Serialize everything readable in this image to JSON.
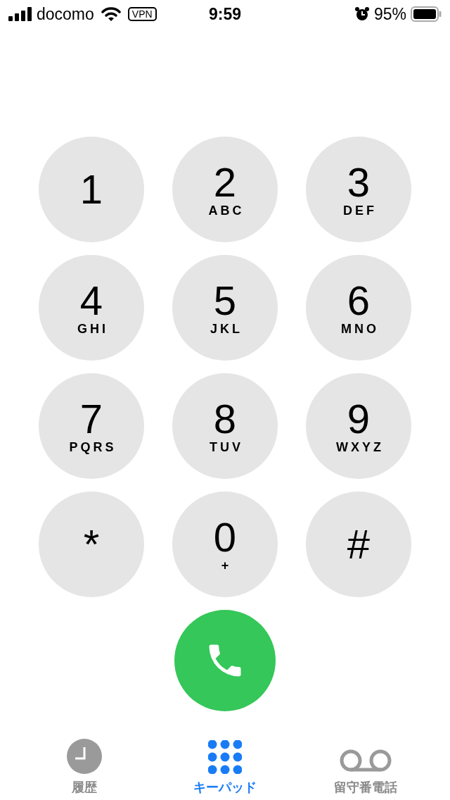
{
  "status_bar": {
    "carrier": "docomo",
    "vpn": "VPN",
    "time": "9:59",
    "battery": "95%"
  },
  "keypad": [
    {
      "digit": "1"
    },
    {
      "digit": "2",
      "letters": "ABC"
    },
    {
      "digit": "3",
      "letters": "DEF"
    },
    {
      "digit": "4",
      "letters": "GHI"
    },
    {
      "digit": "5",
      "letters": "JKL"
    },
    {
      "digit": "6",
      "letters": "MNO"
    },
    {
      "digit": "7",
      "letters": "PQRS"
    },
    {
      "digit": "8",
      "letters": "TUV"
    },
    {
      "digit": "9",
      "letters": "WXYZ"
    },
    {
      "digit": "*"
    },
    {
      "digit": "0",
      "letters": "+"
    },
    {
      "digit": "#"
    }
  ],
  "tabs": [
    {
      "kind": "clock",
      "label": "履歴",
      "selected": false
    },
    {
      "kind": "keypad",
      "label": "キーパッド",
      "selected": true
    },
    {
      "kind": "voicemail",
      "label": "留守番電話",
      "selected": false
    }
  ]
}
